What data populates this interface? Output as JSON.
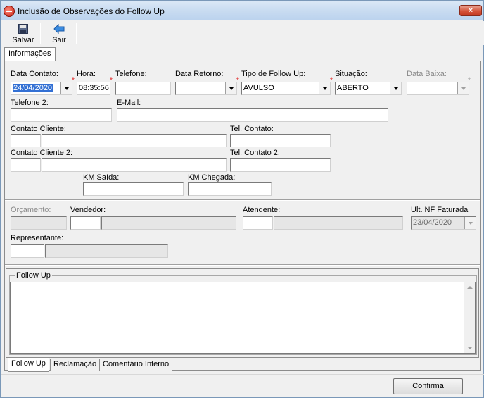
{
  "window": {
    "title": "Inclusão de Observações do Follow Up",
    "close_label": "×"
  },
  "toolbar": {
    "save_label": "Salvar",
    "exit_label": "Sair"
  },
  "tabs_top": [
    "Informações"
  ],
  "fields": {
    "data_contato": {
      "label": "Data Contato:",
      "value": "24/04/2020"
    },
    "hora": {
      "label": "Hora:",
      "value": "08:35:56"
    },
    "telefone": {
      "label": "Telefone:",
      "value": ""
    },
    "data_retorno": {
      "label": "Data Retorno:",
      "value": ""
    },
    "tipo_follow_up": {
      "label": "Tipo de Follow Up:",
      "value": "AVULSO"
    },
    "situacao": {
      "label": "Situação:",
      "value": "ABERTO"
    },
    "data_baixa": {
      "label": "Data Baixa:",
      "value": ""
    },
    "telefone2": {
      "label": "Telefone 2:",
      "value": ""
    },
    "email": {
      "label": "E-Mail:",
      "value": ""
    },
    "contato_cliente": {
      "label": "Contato Cliente:",
      "code": "",
      "value": ""
    },
    "tel_contato": {
      "label": "Tel. Contato:",
      "value": ""
    },
    "contato_cliente2": {
      "label": "Contato Cliente 2:",
      "code": "",
      "value": ""
    },
    "tel_contato2": {
      "label": "Tel. Contato 2:",
      "value": ""
    },
    "km_saida": {
      "label": "KM Saída:",
      "value": ""
    },
    "km_chegada": {
      "label": "KM Chegada:",
      "value": ""
    },
    "orcamento": {
      "label": "Orçamento:",
      "value": ""
    },
    "vendedor": {
      "label": "Vendedor:",
      "code": "",
      "value": ""
    },
    "atendente": {
      "label": "Atendente:",
      "code": "",
      "value": ""
    },
    "ult_nf": {
      "label": "Ult. NF Faturada",
      "value": "23/04/2020"
    },
    "representante": {
      "label": "Representante:",
      "code": "",
      "value": ""
    }
  },
  "required_mark": "*",
  "follow_up_group": {
    "title": "Follow Up",
    "text": ""
  },
  "tabs_bottom": [
    "Follow Up",
    "Reclamação",
    "Comentário Interno"
  ],
  "confirm_label": "Confirma",
  "colors": {
    "selection": "#3370d4",
    "required": "#e02020"
  }
}
